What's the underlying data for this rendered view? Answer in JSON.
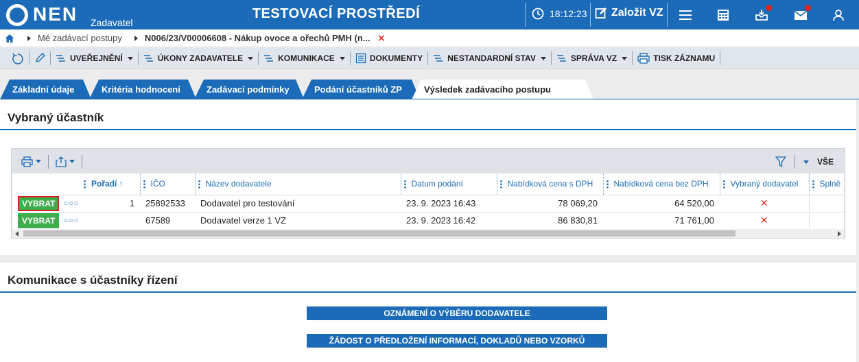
{
  "header": {
    "logo": "NEN",
    "logo_sub": "Zadavatel",
    "environment": "TESTOVACÍ PROSTŘEDÍ",
    "time": "18:12:23",
    "new_vz": "Založit VZ"
  },
  "breadcrumb": {
    "item1": "Mé zadávací postupy",
    "item2": "N006/23/V00006608 - Nákup ovoce a ořechů PMH (n..."
  },
  "actions": [
    {
      "label": "UVEŘEJNĚNÍ",
      "dropdown": true
    },
    {
      "label": "ÚKONY ZADAVATELE",
      "dropdown": true
    },
    {
      "label": "KOMUNIKACE",
      "dropdown": true
    },
    {
      "label": "DOKUMENTY",
      "dropdown": false
    },
    {
      "label": "NESTANDARDNÍ STAV",
      "dropdown": true
    },
    {
      "label": "SPRÁVA VZ",
      "dropdown": true
    },
    {
      "label": "TISK ZÁZNAMU",
      "dropdown": false
    }
  ],
  "tabs": [
    {
      "label": "Základní údaje"
    },
    {
      "label": "Kritéria hodnocení"
    },
    {
      "label": "Zadávací podmínky"
    },
    {
      "label": "Podání účastníků ZP"
    },
    {
      "label": "Výsledek zadávacího postupu",
      "active": true
    }
  ],
  "selected_section": {
    "title": "Vybraný účastník",
    "filter_label": "VŠE",
    "columns": [
      "Pořadí",
      "IČO",
      "Název dodavatele",
      "Datum podání",
      "Nabídková cena s DPH",
      "Nabídková cena bez DPH",
      "Vybraný dodavatel",
      "Splně"
    ],
    "select_label": "VYBRAT",
    "rows": [
      {
        "poradi": "1",
        "ico": "25892533",
        "nazev": "Dodavatel pro testování",
        "datum": "23. 9. 2023 16:43",
        "cena_s_dph": "78 069,20",
        "cena_bez_dph": "64 520,00"
      },
      {
        "poradi": "",
        "ico": "67589",
        "nazev": "Dodavatel verze 1 VZ",
        "datum": "23. 9. 2023 16:42",
        "cena_s_dph": "86 830,81",
        "cena_bez_dph": "71 761,00"
      }
    ]
  },
  "communication_section": {
    "title": "Komunikace s účastníky řízení",
    "buttons": [
      "OZNÁMENÍ O VÝBĚRU DODAVATELE",
      "ŽÁDOST O PŘEDLOŽENÍ INFORMACÍ, DOKLADŮ NEBO VZORKŮ"
    ]
  },
  "colors": {
    "primary": "#1b6bb8",
    "success": "#3dae4b",
    "danger": "#e2231a"
  }
}
